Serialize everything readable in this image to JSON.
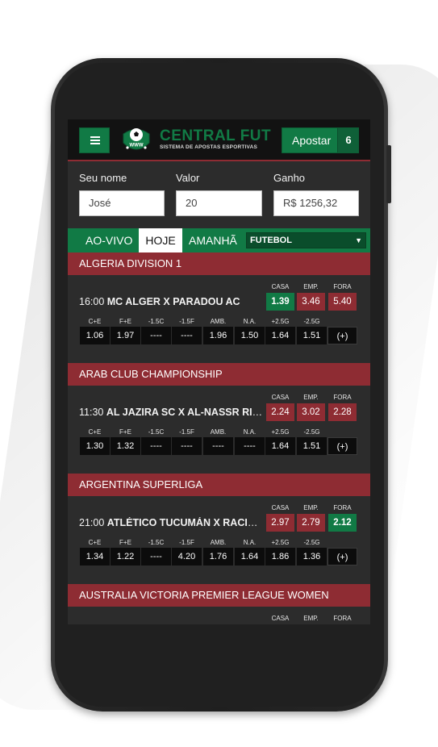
{
  "header": {
    "logo_badge": "WWW",
    "logo_title": "CENTRAL FUT",
    "logo_subtitle": "SISTEMA DE APOSTAS ESPORTIVAS",
    "bet_label": "Apostar",
    "bet_count": "6",
    "menu_icon": "hamburger-menu-icon"
  },
  "form": {
    "name_label": "Seu nome",
    "name_value": "José",
    "value_label": "Valor",
    "value_value": "20",
    "gain_label": "Ganho",
    "gain_value": "R$ 1256,32"
  },
  "tabs": [
    {
      "label": "AO-VIVO",
      "active": false
    },
    {
      "label": "HOJE",
      "active": true
    },
    {
      "label": "AMANHÃ",
      "active": false
    }
  ],
  "sport_select": {
    "value": "FUTEBOL"
  },
  "colors": {
    "green": "#117a45",
    "red": "#8e2c33",
    "dark": "#2c2c2c"
  },
  "odd_labels": [
    "CASA",
    "EMP.",
    "FORA"
  ],
  "market_labels": [
    "C+E",
    "F+E",
    "-1.5C",
    "-1.5F",
    "AMB.",
    "N.A.",
    "+2.5G",
    "-2.5G"
  ],
  "leagues": [
    {
      "name": "ALGERIA DIVISION 1",
      "time": "16:00",
      "teams": "MC ALGER X PARADOU AC",
      "odds": [
        "1.39",
        "3.46",
        "5.40"
      ],
      "selected_odd": 0,
      "markets": [
        "1.06",
        "1.97",
        "----",
        "----",
        "1.96",
        "1.50",
        "1.64",
        "1.51",
        "(+)"
      ]
    },
    {
      "name": "ARAB CLUB CHAMPIONSHIP",
      "time": "11:30",
      "teams": "AL JAZIRA SC X AL-NASSR RIY...",
      "odds": [
        "2.24",
        "3.02",
        "2.28"
      ],
      "selected_odd": -1,
      "markets": [
        "1.30",
        "1.32",
        "----",
        "----",
        "----",
        "----",
        "1.64",
        "1.51",
        "(+)"
      ]
    },
    {
      "name": "ARGENTINA SUPERLIGA",
      "time": "21:00",
      "teams": "ATLÉTICO TUCUMÁN X RACING...",
      "odds": [
        "2.97",
        "2.79",
        "2.12"
      ],
      "selected_odd": 2,
      "markets": [
        "1.34",
        "1.22",
        "----",
        "4.20",
        "1.76",
        "1.64",
        "1.86",
        "1.36",
        "(+)"
      ]
    },
    {
      "name": "AUSTRALIA VICTORIA PREMIER LEAGUE WOMEN"
    }
  ]
}
